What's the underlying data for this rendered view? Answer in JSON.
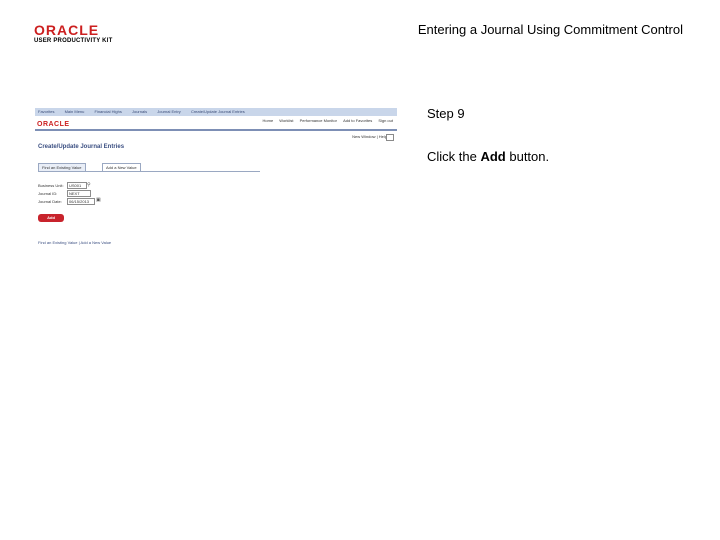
{
  "header": {
    "logo_word": "ORACLE",
    "logo_sub": "USER PRODUCTIVITY KIT",
    "title": "Entering a Journal Using Commitment Control"
  },
  "screenshot": {
    "navbar": [
      "Favorites",
      "Main Menu",
      "Financial Highs",
      "Journals",
      "Journal Entry",
      "Create/Update Journal Entries"
    ],
    "logo_text": "ORACLE",
    "top_menu": [
      "Home",
      "Worklist",
      "Performance Monitor",
      "Add to Favorites",
      "Sign out"
    ],
    "new_window": "New Window | Help",
    "page_heading": "Create/Update Journal Entries",
    "tabs": {
      "find": "Find an Existing Value",
      "add": "Add a New Value"
    },
    "form": {
      "business_unit_label": "Business Unit:",
      "business_unit_value": "US001",
      "journal_id_label": "Journal ID:",
      "journal_id_value": "NEXT",
      "journal_date_label": "Journal Date:",
      "journal_date_value": "06/15/2013"
    },
    "add_button": "Add",
    "bottom_links": "Find an Existing Value | Add a New Value"
  },
  "instructions": {
    "step": "Step 9",
    "prefix": "Click the ",
    "bold": "Add",
    "suffix": " button."
  }
}
